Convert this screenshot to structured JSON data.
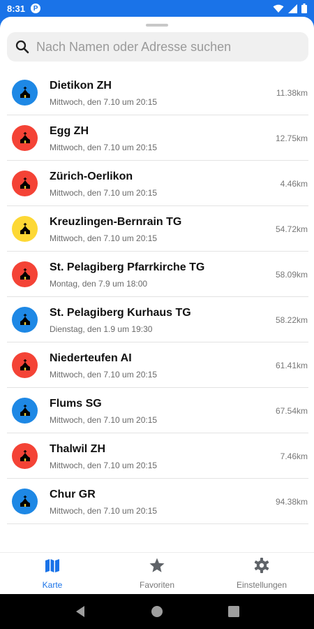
{
  "status_bar": {
    "time": "8:31",
    "app_icon_glyph": "P"
  },
  "search": {
    "placeholder": "Nach Namen oder Adresse suchen",
    "value": ""
  },
  "colors": {
    "accent": "#1a73e8",
    "blue": "#1e88e5",
    "red": "#f44336",
    "yellow": "#fdd835"
  },
  "locations": [
    {
      "name": "Dietikon ZH",
      "date": "Mittwoch, den 7.10 um 20:15",
      "distance": "11.38km",
      "marker": "blue",
      "icon": "church-icon"
    },
    {
      "name": "Egg ZH",
      "date": "Mittwoch, den 7.10 um 20:15",
      "distance": "12.75km",
      "marker": "red",
      "icon": "church-icon"
    },
    {
      "name": "Zürich-Oerlikon",
      "date": "Mittwoch, den 7.10 um 20:15",
      "distance": "4.46km",
      "marker": "red",
      "icon": "church-icon"
    },
    {
      "name": "Kreuzlingen-Bernrain TG",
      "date": "Mittwoch, den 7.10 um 20:15",
      "distance": "54.72km",
      "marker": "yellow",
      "icon": "church-icon"
    },
    {
      "name": "St. Pelagiberg Pfarrkirche TG",
      "date": "Montag, den 7.9 um 18:00",
      "distance": "58.09km",
      "marker": "red",
      "icon": "church-icon"
    },
    {
      "name": "St. Pelagiberg Kurhaus TG",
      "date": "Dienstag, den 1.9 um 19:30",
      "distance": "58.22km",
      "marker": "blue",
      "icon": "church-icon"
    },
    {
      "name": "Niederteufen AI",
      "date": "Mittwoch, den 7.10 um 20:15",
      "distance": "61.41km",
      "marker": "red",
      "icon": "church-icon"
    },
    {
      "name": "Flums SG",
      "date": "Mittwoch, den 7.10 um 20:15",
      "distance": "67.54km",
      "marker": "blue",
      "icon": "church-icon"
    },
    {
      "name": "Thalwil ZH",
      "date": "Mittwoch, den 7.10 um 20:15",
      "distance": "7.46km",
      "marker": "red",
      "icon": "church-icon"
    },
    {
      "name": "Chur GR",
      "date": "Mittwoch, den 7.10 um 20:15",
      "distance": "94.38km",
      "marker": "blue",
      "icon": "church-icon"
    }
  ],
  "bottom_nav": {
    "items": [
      {
        "label": "Karte",
        "icon": "map-icon",
        "active": true
      },
      {
        "label": "Favoriten",
        "icon": "star-icon",
        "active": false
      },
      {
        "label": "Einstellungen",
        "icon": "gear-icon",
        "active": false
      }
    ]
  }
}
